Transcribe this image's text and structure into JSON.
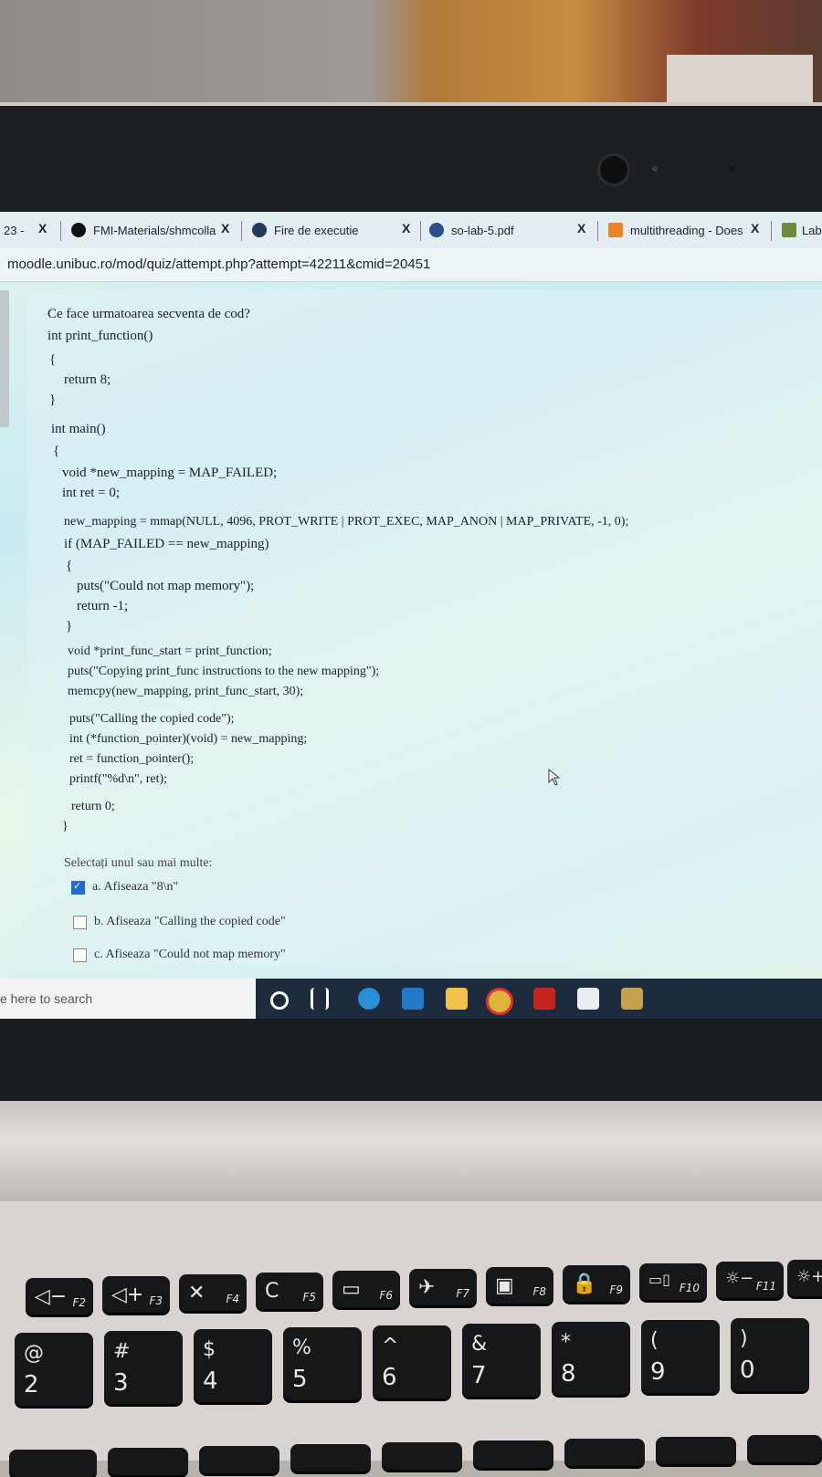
{
  "tabs": [
    {
      "label": "23 -",
      "close": "X"
    },
    {
      "label": "FMI-Materials/shmcolla",
      "close": "X"
    },
    {
      "label": "Fire de executie",
      "close": "X"
    },
    {
      "label": "so-lab-5.pdf",
      "close": "X"
    },
    {
      "label": "multithreading - Does",
      "close": "X"
    },
    {
      "label": "Lab"
    }
  ],
  "address_bar": {
    "url": "moodle.unibuc.ro/mod/quiz/attempt.php?attempt=42211&cmid=20451"
  },
  "question": {
    "prompt": "Ce face urmatoarea secventa de cod?",
    "code_lines": [
      "int print_function()",
      "{",
      "return 8;",
      "}",
      "int main()",
      "{",
      "void *new_mapping = MAP_FAILED;",
      "int ret = 0;",
      "new_mapping = mmap(NULL, 4096, PROT_WRITE | PROT_EXEC, MAP_ANON | MAP_PRIVATE, -1, 0);",
      "if (MAP_FAILED == new_mapping)",
      "{",
      "puts(\"Could not map memory\");",
      "return -1;",
      "}",
      "void *print_func_start = print_function;",
      "puts(\"Copying print_func instructions to the new mapping\");",
      "memcpy(new_mapping, print_func_start, 30);",
      "puts(\"Calling the copied code\");",
      "int (*function_pointer)(void) = new_mapping;",
      "ret = function_pointer();",
      "printf(\"%d\\n\", ret);",
      "return 0;",
      "}"
    ],
    "instruction": "Selectați unul sau mai multe:",
    "options": [
      {
        "label": "a. Afiseaza \"8\\n\"",
        "checked": true
      },
      {
        "label": "b. Afiseaza \"Calling the copied code\"",
        "checked": false
      },
      {
        "label": "c. Afiseaza \"Could not map memory\"",
        "checked": false
      }
    ]
  },
  "taskbar": {
    "search_placeholder": "e here to search"
  },
  "keyboard": {
    "fn_row": [
      {
        "icon": "◁−",
        "fn": "F2"
      },
      {
        "icon": "◁+",
        "fn": "F3"
      },
      {
        "icon": "✕",
        "fn": "F4"
      },
      {
        "icon": "C",
        "fn": "F5"
      },
      {
        "icon": "▭",
        "fn": "F6"
      },
      {
        "icon": "✈",
        "fn": "F7"
      },
      {
        "icon": "▣",
        "fn": "F8"
      },
      {
        "icon": "🔒",
        "fn": "F9"
      },
      {
        "icon": "▭▯",
        "fn": "F10"
      },
      {
        "icon": "☼−",
        "fn": "F11"
      },
      {
        "icon": "☼+",
        "fn": ""
      }
    ],
    "num_row": [
      {
        "sym": "@",
        "num": "2"
      },
      {
        "sym": "#",
        "num": "3"
      },
      {
        "sym": "$",
        "num": "4"
      },
      {
        "sym": "%",
        "num": "5"
      },
      {
        "sym": "^",
        "num": "6"
      },
      {
        "sym": "&",
        "num": "7"
      },
      {
        "sym": "*",
        "num": "8"
      },
      {
        "sym": "(",
        "num": "9"
      },
      {
        "sym": ")",
        "num": "0"
      }
    ]
  },
  "colors": {
    "accent": "#1f6fd1",
    "bezel": "#1d2022",
    "taskbar": "#1c2b3d"
  }
}
